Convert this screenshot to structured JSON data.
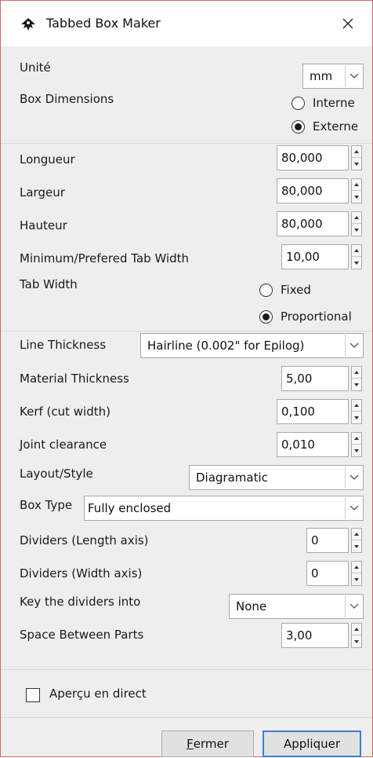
{
  "window": {
    "title": "Tabbed Box Maker"
  },
  "unit": {
    "label": "Unité",
    "value": "mm"
  },
  "box_dimensions": {
    "label": "Box Dimensions",
    "options": [
      "Interne",
      "Externe"
    ],
    "selected": "Externe"
  },
  "length": {
    "label": "Longueur",
    "value": "80,000"
  },
  "width": {
    "label": "Largeur",
    "value": "80,000"
  },
  "height": {
    "label": "Hauteur",
    "value": "80,000"
  },
  "min_tab_width": {
    "label": "Minimum/Prefered Tab Width",
    "value": "10,00"
  },
  "tab_width": {
    "label": "Tab Width",
    "options": [
      "Fixed",
      "Proportional"
    ],
    "selected": "Proportional"
  },
  "line_thickness": {
    "label": "Line Thickness",
    "value": "Hairline (0.002\" for Epilog)"
  },
  "material_thickness": {
    "label": "Material Thickness",
    "value": "5,00"
  },
  "kerf": {
    "label": "Kerf (cut width)",
    "value": "0,100"
  },
  "joint_clearance": {
    "label": "Joint clearance",
    "value": "0,010"
  },
  "layout_style": {
    "label": "Layout/Style",
    "value": "Diagramatic"
  },
  "box_type": {
    "label": "Box Type",
    "value": "Fully enclosed"
  },
  "dividers_length": {
    "label": "Dividers (Length axis)",
    "value": "0"
  },
  "dividers_width": {
    "label": "Dividers (Width axis)",
    "value": "0"
  },
  "key_dividers": {
    "label": "Key the dividers into",
    "value": "None"
  },
  "space_between": {
    "label": "Space Between Parts",
    "value": "3,00"
  },
  "live_preview": {
    "label": "Aperçu en direct",
    "checked": false
  },
  "buttons": {
    "close_first": "F",
    "close_rest": "ermer",
    "apply": "Appliquer"
  }
}
